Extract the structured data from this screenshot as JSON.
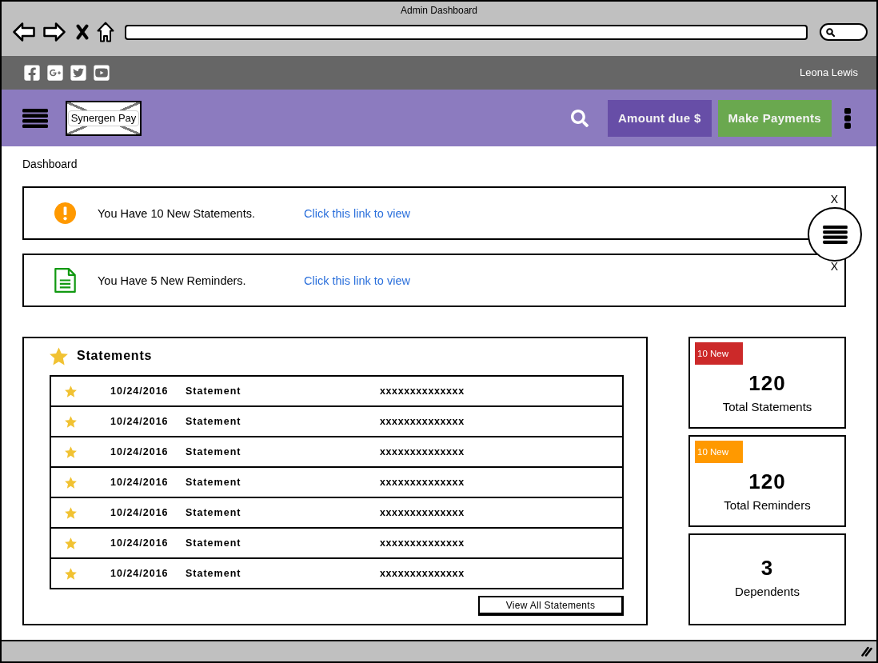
{
  "window": {
    "title": "Admin Dashboard"
  },
  "social_bar": {
    "user_name": "Leona Lewis"
  },
  "header": {
    "logo": "Synergen Pay",
    "buttons": [
      {
        "label": "Amount due $",
        "kind": "due"
      },
      {
        "label": "Make Payments",
        "kind": "pay"
      }
    ]
  },
  "page_title": "Dashboard",
  "alerts": [
    {
      "kind": "warning",
      "message": "You Have 10 New Statements.",
      "link": "Click this link to view",
      "close": "X"
    },
    {
      "kind": "document",
      "message": "You Have 5 New Reminders.",
      "link": "Click this link to view",
      "close": "X"
    }
  ],
  "statements": {
    "title": "Statements",
    "rows": [
      {
        "starred": true,
        "date": "10/24/2016",
        "type": "Statement",
        "number": "xxxxxxxxxxxxxx"
      },
      {
        "starred": true,
        "date": "10/24/2016",
        "type": "Statement",
        "number": "xxxxxxxxxxxxxx"
      },
      {
        "starred": true,
        "date": "10/24/2016",
        "type": "Statement",
        "number": "xxxxxxxxxxxxxx"
      },
      {
        "starred": true,
        "date": "10/24/2016",
        "type": "Statement",
        "number": "xxxxxxxxxxxxxx"
      },
      {
        "starred": true,
        "date": "10/24/2016",
        "type": "Statement",
        "number": "xxxxxxxxxxxxxx"
      },
      {
        "starred": true,
        "date": "10/24/2016",
        "type": "Statement",
        "number": "xxxxxxxxxxxxxx"
      },
      {
        "starred": true,
        "date": "10/24/2016",
        "type": "Statement",
        "number": "xxxxxxxxxxxxxx"
      }
    ],
    "button": "View All Statements"
  },
  "stat_cards": [
    {
      "badge": {
        "text": "10 New",
        "color": "#cc2929"
      },
      "value": "120",
      "label": "Total Statements"
    },
    {
      "badge": {
        "text": "10 New",
        "color": "#ff9900"
      },
      "value": "120",
      "label": "Total Reminders"
    },
    {
      "value": "3",
      "label": "Dependents"
    }
  ]
}
